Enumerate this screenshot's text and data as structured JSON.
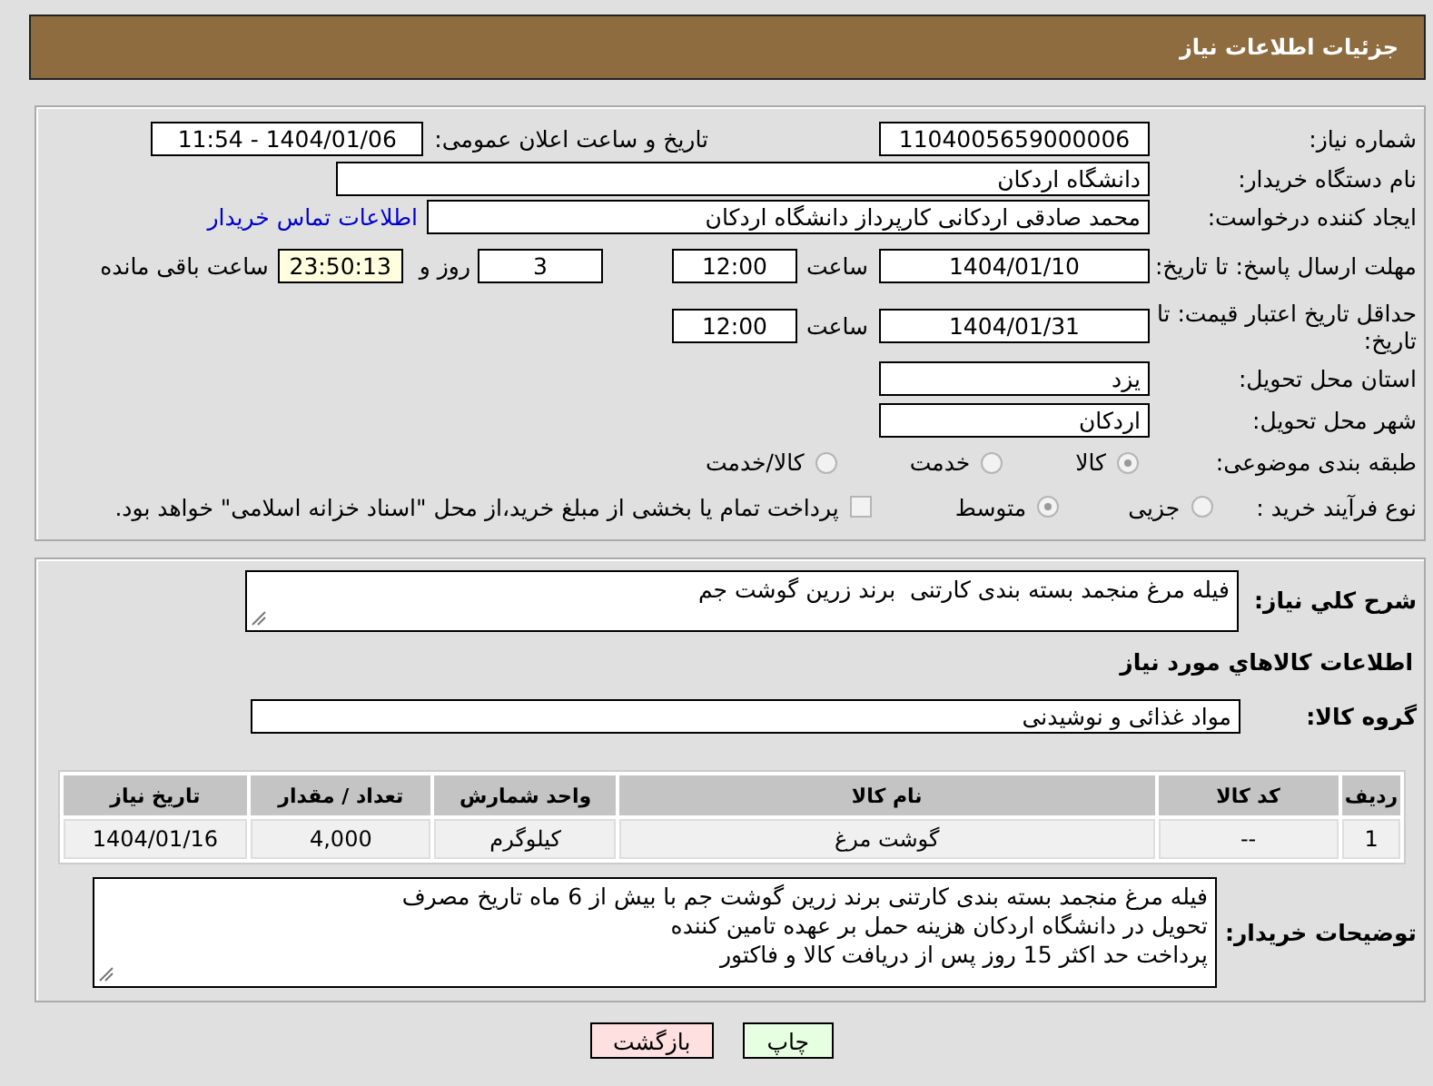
{
  "header": {
    "title": "جزئیات اطلاعات نیاز"
  },
  "details": {
    "need_number": {
      "label": "شماره نیاز:",
      "value": "1104005659000006"
    },
    "announce": {
      "label": "تاریخ و ساعت اعلان عمومی:",
      "value": "1404/01/06 - 11:54"
    },
    "buyer_org": {
      "label": "نام دستگاه خریدار:",
      "value": "دانشگاه اردکان"
    },
    "requester": {
      "label": "ایجاد کننده درخواست:",
      "value": "محمد صادقی اردکانی کارپرداز دانشگاه اردکان",
      "link": "اطلاعات تماس خریدار"
    },
    "response_deadline": {
      "label": "مهلت ارسال پاسخ: تا تاریخ:",
      "date": "1404/01/10",
      "time_label": "ساعت",
      "time": "12:00",
      "days": "3",
      "days_label": "روز و",
      "remaining": "23:50:13",
      "remaining_label": "ساعت باقی مانده"
    },
    "price_validity": {
      "label": "حداقل تاریخ اعتبار قیمت: تا تاریخ:",
      "date": "1404/01/31",
      "time_label": "ساعت",
      "time": "12:00"
    },
    "province": {
      "label": "استان محل تحویل:",
      "value": "یزد"
    },
    "city": {
      "label": "شهر محل تحویل:",
      "value": "اردکان"
    },
    "category": {
      "label": "طبقه بندی موضوعی:",
      "options": [
        {
          "label": "کالا",
          "selected": true
        },
        {
          "label": "خدمت",
          "selected": false
        },
        {
          "label": "کالا/خدمت",
          "selected": false
        }
      ]
    },
    "purchase_type": {
      "label": "نوع فرآیند خرید :",
      "options": [
        {
          "label": "جزیی",
          "selected": false
        },
        {
          "label": "متوسط",
          "selected": true
        }
      ],
      "treasury": {
        "label": "پرداخت تمام یا بخشی از مبلغ خرید،از محل \"اسناد خزانه اسلامی\" خواهد بود.",
        "checked": false
      }
    }
  },
  "needs": {
    "description": {
      "label": "شرح کلي نياز:",
      "value": "فیله مرغ منجمد بسته بندی کارتنی  برند زرین گوشت جم"
    },
    "goods_title": "اطلاعات كالاهاي مورد نياز",
    "goods_group": {
      "label": "گروه کالا:",
      "value": "مواد غذائی و نوشیدنی"
    },
    "table": {
      "columns": [
        "ردیف",
        "کد کالا",
        "نام کالا",
        "واحد شمارش",
        "تعداد / مقدار",
        "تاریخ نیاز"
      ],
      "rows": [
        [
          "1",
          "--",
          "گوشت مرغ",
          "کیلوگرم",
          "4,000",
          "1404/01/16"
        ]
      ]
    },
    "buyer_notes": {
      "label": "توضیحات خریدار:",
      "value": "فیله مرغ منجمد بسته بندی کارتنی برند زرین گوشت جم با بیش از 6 ماه تاریخ مصرف\nتحویل در دانشگاه اردکان هزینه حمل بر عهده تامین کننده\nپرداخت حد اکثر 15 روز پس از دریافت کالا و فاکتور"
    }
  },
  "buttons": [
    {
      "label": "چاپ",
      "kind": "print"
    },
    {
      "label": "بازگشت",
      "kind": "back"
    }
  ]
}
